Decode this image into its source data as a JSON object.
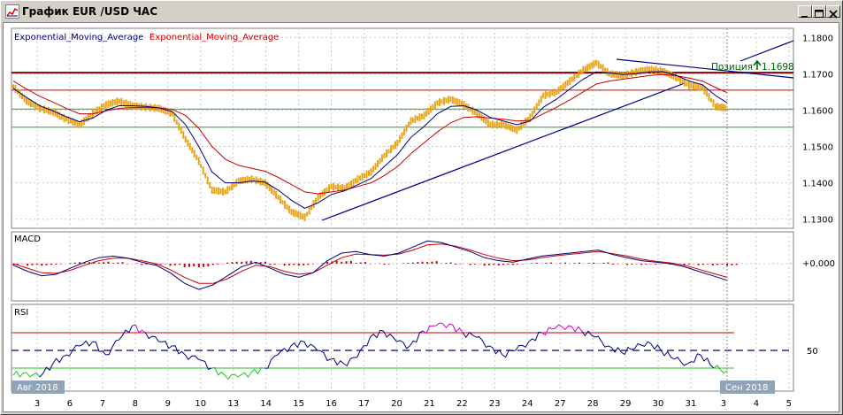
{
  "window": {
    "title": "График EUR /USD ЧАС",
    "buttons": [
      "minimize",
      "maximize",
      "close"
    ]
  },
  "price_panel": {
    "legend_blue": "Exponential_Moving_Average",
    "legend_red": "Exponential_Moving_Average",
    "position_label": "Позиция",
    "position_value": "1.1698",
    "y_labels": [
      "1.1800",
      "1.1700",
      "1.1600",
      "1.1500",
      "1.1400",
      "1.1300"
    ]
  },
  "macd_panel": {
    "label": "MACD",
    "zero_label": "+0.000"
  },
  "rsi_panel": {
    "label": "RSI",
    "level_label": "50"
  },
  "x_axis": {
    "start_label": "Авг 2018",
    "end_label": "Сен 2018",
    "days": [
      "3",
      "6",
      "7",
      "8",
      "9",
      "10",
      "13",
      "14",
      "15",
      "16",
      "17",
      "20",
      "21",
      "22",
      "23",
      "24",
      "27",
      "28",
      "29",
      "30",
      "31",
      "3",
      "4",
      "5"
    ]
  },
  "colors": {
    "price": "#e8a317",
    "ema_fast": "#000080",
    "ema_slow": "#cc0000",
    "support": "#2ea02e",
    "resistance": "#8b0000",
    "rsi_overbought": "#cc00cc",
    "rsi_oversold": "#22c022",
    "badge": "#90a4b8"
  },
  "chart_data": [
    {
      "type": "line",
      "name": "price",
      "x": [
        0,
        15,
        30,
        45,
        60,
        75,
        90,
        105,
        120,
        135,
        150,
        165,
        180,
        195,
        210,
        225,
        240,
        255,
        270,
        285,
        300,
        315,
        330,
        345,
        360,
        375,
        390,
        405,
        420,
        435,
        450,
        465,
        480,
        495,
        510,
        525,
        540,
        555,
        570,
        585,
        600,
        615,
        630,
        645,
        660,
        675,
        690,
        705,
        720,
        735,
        750,
        765,
        780,
        795,
        808
      ],
      "values": [
        1.1665,
        1.1625,
        1.1605,
        1.1595,
        1.1575,
        1.156,
        1.159,
        1.1615,
        1.1625,
        1.1612,
        1.1608,
        1.1605,
        1.159,
        1.152,
        1.146,
        1.138,
        1.1375,
        1.1405,
        1.141,
        1.14,
        1.136,
        1.132,
        1.1305,
        1.136,
        1.139,
        1.1385,
        1.141,
        1.143,
        1.1475,
        1.151,
        1.157,
        1.1585,
        1.162,
        1.163,
        1.1615,
        1.159,
        1.156,
        1.156,
        1.1545,
        1.158,
        1.164,
        1.165,
        1.168,
        1.171,
        1.173,
        1.17,
        1.1695,
        1.1705,
        1.1712,
        1.1708,
        1.169,
        1.1668,
        1.1662,
        1.161,
        1.1605
      ],
      "ema_fast": [
        1.166,
        1.1635,
        1.1612,
        1.1598,
        1.1582,
        1.1568,
        1.1578,
        1.16,
        1.1612,
        1.1612,
        1.161,
        1.1606,
        1.1596,
        1.156,
        1.15,
        1.143,
        1.14,
        1.14,
        1.1405,
        1.1402,
        1.138,
        1.1352,
        1.133,
        1.1345,
        1.1368,
        1.1378,
        1.1395,
        1.1412,
        1.1445,
        1.1478,
        1.1525,
        1.1555,
        1.159,
        1.161,
        1.1612,
        1.16,
        1.158,
        1.157,
        1.156,
        1.157,
        1.1608,
        1.163,
        1.1658,
        1.1685,
        1.1705,
        1.1702,
        1.1698,
        1.17,
        1.1705,
        1.1706,
        1.1696,
        1.168,
        1.167,
        1.164,
        1.162
      ],
      "ema_slow": [
        1.168,
        1.1658,
        1.1638,
        1.1622,
        1.1605,
        1.159,
        1.159,
        1.1598,
        1.1605,
        1.1607,
        1.1607,
        1.1606,
        1.1602,
        1.1585,
        1.155,
        1.15,
        1.1465,
        1.1448,
        1.144,
        1.1432,
        1.1415,
        1.1395,
        1.1375,
        1.137,
        1.1375,
        1.138,
        1.139,
        1.14,
        1.142,
        1.1445,
        1.148,
        1.151,
        1.154,
        1.1565,
        1.158,
        1.1582,
        1.1578,
        1.1575,
        1.157,
        1.1572,
        1.159,
        1.1608,
        1.1628,
        1.165,
        1.1672,
        1.168,
        1.1685,
        1.169,
        1.1695,
        1.1698,
        1.1695,
        1.1688,
        1.168,
        1.1662,
        1.1648
      ],
      "horizontal_lines": {
        "brown": 1.1703,
        "red": 1.1655,
        "green_upper": 1.1603,
        "green_lower": 1.1553
      },
      "ylim": [
        1.1275,
        1.1825
      ]
    },
    {
      "type": "line",
      "name": "MACD",
      "values": [
        -0.05,
        -0.25,
        -0.4,
        -0.35,
        -0.15,
        0.05,
        0.2,
        0.25,
        0.18,
        0.05,
        -0.05,
        -0.3,
        -0.65,
        -0.85,
        -0.7,
        -0.4,
        -0.1,
        0.05,
        -0.15,
        -0.35,
        -0.45,
        -0.3,
        0.1,
        0.35,
        0.4,
        0.3,
        0.25,
        0.35,
        0.55,
        0.75,
        0.7,
        0.55,
        0.4,
        0.2,
        0.1,
        0.05,
        0.15,
        0.25,
        0.3,
        0.35,
        0.4,
        0.45,
        0.3,
        0.2,
        0.1,
        0.05,
        0.0,
        -0.1,
        -0.25,
        -0.4,
        -0.55
      ],
      "signal": [
        0.0,
        -0.15,
        -0.3,
        -0.32,
        -0.22,
        -0.05,
        0.1,
        0.18,
        0.18,
        0.1,
        0.0,
        -0.2,
        -0.45,
        -0.65,
        -0.65,
        -0.5,
        -0.25,
        -0.05,
        -0.1,
        -0.25,
        -0.35,
        -0.3,
        -0.05,
        0.2,
        0.32,
        0.3,
        0.28,
        0.32,
        0.45,
        0.62,
        0.65,
        0.58,
        0.45,
        0.3,
        0.18,
        0.1,
        0.12,
        0.2,
        0.26,
        0.31,
        0.36,
        0.4,
        0.33,
        0.25,
        0.15,
        0.08,
        0.03,
        -0.05,
        -0.18,
        -0.32,
        -0.45
      ],
      "ylim": [
        -1,
        1
      ]
    },
    {
      "type": "line",
      "name": "RSI",
      "values": [
        22,
        25,
        20,
        35,
        45,
        55,
        60,
        45,
        62,
        78,
        70,
        60,
        55,
        45,
        40,
        30,
        22,
        20,
        25,
        30,
        45,
        55,
        60,
        50,
        40,
        35,
        42,
        65,
        72,
        60,
        55,
        72,
        78,
        80,
        70,
        65,
        55,
        45,
        50,
        60,
        70,
        75,
        78,
        72,
        65,
        55,
        48,
        52,
        60,
        50,
        40,
        35,
        45,
        30,
        27
      ],
      "ylim": [
        0,
        100
      ],
      "levels": [
        70,
        50,
        30
      ]
    }
  ]
}
